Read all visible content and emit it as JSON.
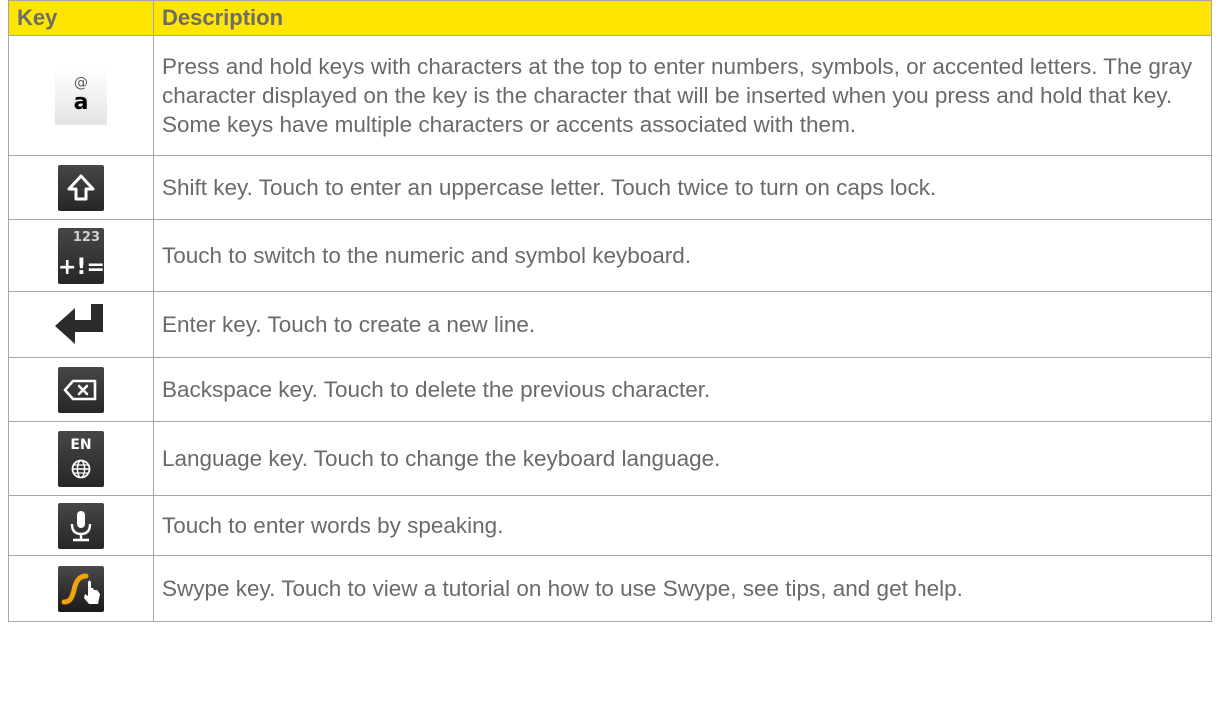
{
  "table": {
    "header_key": "Key",
    "header_description": "Description",
    "rows": [
      {
        "icon": "at-symbol-key-icon",
        "key_top": "@",
        "key_main": "a",
        "description": "Press and hold keys with characters at the top to enter numbers, symbols, or accented letters. The gray character displayed on the key is the character that will be inserted when you press and hold that key. Some keys have multiple characters or accents associated with them."
      },
      {
        "icon": "shift-key-icon",
        "description": "Shift key. Touch to enter an uppercase letter. Touch twice to turn on caps lock."
      },
      {
        "icon": "numeric-symbol-key-icon",
        "key_top": "123",
        "key_main": "+!=",
        "description": "Touch to switch to the numeric and symbol keyboard."
      },
      {
        "icon": "enter-key-icon",
        "description": "Enter key. Touch to create a new line."
      },
      {
        "icon": "backspace-key-icon",
        "description": "Backspace key. Touch to delete the previous character."
      },
      {
        "icon": "language-key-icon",
        "key_top": "EN",
        "key_main": "⊕",
        "description": "Language key. Touch to change the keyboard language."
      },
      {
        "icon": "microphone-key-icon",
        "description": "Touch to enter words by speaking."
      },
      {
        "icon": "swype-key-icon",
        "description": "Swype key. Touch to view a tutorial on how to use Swype, see tips, and get help."
      }
    ]
  },
  "colors": {
    "header_bg": "#ffe600",
    "header_text": "#6c6c6c",
    "body_text": "#6a6a6a",
    "border": "#a6a6a6",
    "swype_orange": "#f2a20c"
  }
}
